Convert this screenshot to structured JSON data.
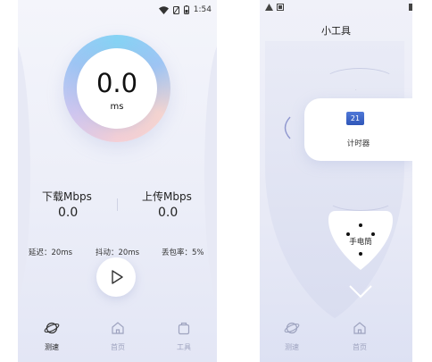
{
  "left_screen": {
    "status_time": "1:54",
    "gauge": {
      "value": "0.0",
      "unit": "ms"
    },
    "download": {
      "label": "下载Mbps",
      "value": "0.0"
    },
    "upload": {
      "label": "上传Mbps",
      "value": "0.0"
    },
    "stats": {
      "latency": "延迟：20ms",
      "jitter": "抖动：20ms",
      "packet_loss": "丢包率：5%"
    },
    "nav": [
      {
        "label": "测速",
        "icon": "planet-icon",
        "active": true
      },
      {
        "label": "首页",
        "icon": "home-icon",
        "active": false
      },
      {
        "label": "工具",
        "icon": "bag-icon",
        "active": false
      }
    ]
  },
  "right_screen": {
    "title": "小工具",
    "timer": {
      "label": "计时器",
      "icon_text": "21"
    },
    "flashlight": {
      "label": "手电筒"
    },
    "nav": [
      {
        "label": "测速",
        "icon": "planet-icon"
      },
      {
        "label": "首页",
        "icon": "home-icon"
      }
    ]
  },
  "colors": {
    "accent_blue": "#86d3f4",
    "accent_pink": "#f3cfd6",
    "background": "#eceef8"
  }
}
